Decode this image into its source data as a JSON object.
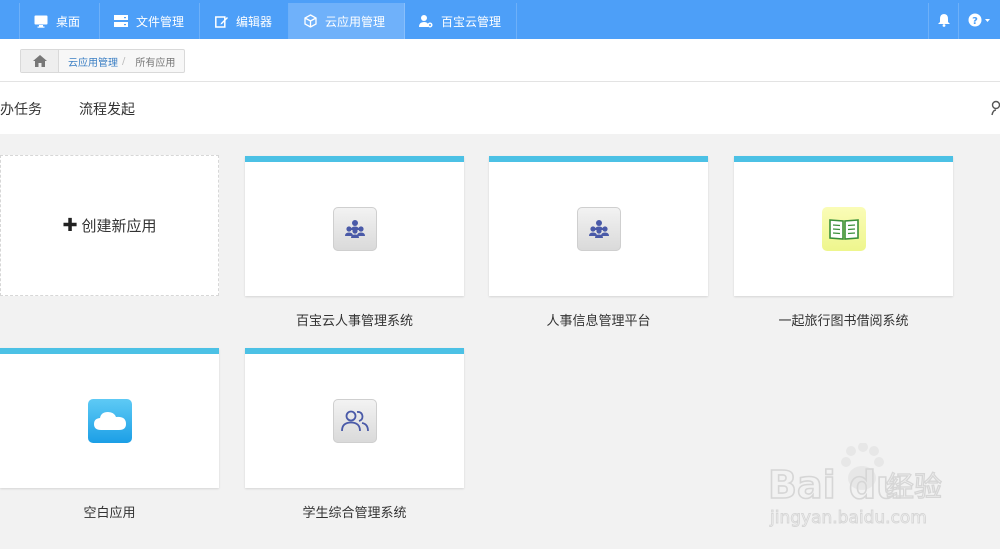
{
  "topnav": {
    "items": [
      {
        "label": "桌面",
        "icon": "monitor-icon"
      },
      {
        "label": "文件管理",
        "icon": "server-icon"
      },
      {
        "label": "编辑器",
        "icon": "edit-icon"
      },
      {
        "label": "云应用管理",
        "icon": "cube-icon"
      },
      {
        "label": "百宝云管理",
        "icon": "user-gear-icon"
      }
    ],
    "active_index": 3,
    "right_icons": [
      "bell-icon",
      "help-icon"
    ],
    "color": "#4d9ff8"
  },
  "breadcrumb": {
    "items": [
      "云应用管理",
      "所有应用"
    ],
    "separator": "/"
  },
  "tabs": [
    "待办任务",
    "流程发起"
  ],
  "create_card": {
    "label": "创建新应用",
    "plus": "✚"
  },
  "apps": [
    {
      "name": "百宝云人事管理系统",
      "icon": "people-group-icon"
    },
    {
      "name": "人事信息管理平台",
      "icon": "people-group-icon"
    },
    {
      "name": "一起旅行图书借阅系统",
      "icon": "book-icon"
    },
    {
      "name": "空白应用",
      "icon": "cloud-icon"
    },
    {
      "name": "学生综合管理系统",
      "icon": "users-outline-icon"
    }
  ],
  "accent_color": "#4cc1e5",
  "watermark": {
    "brand": "Bai du",
    "suffix": "经验",
    "url": "jingyan.baidu.com"
  }
}
